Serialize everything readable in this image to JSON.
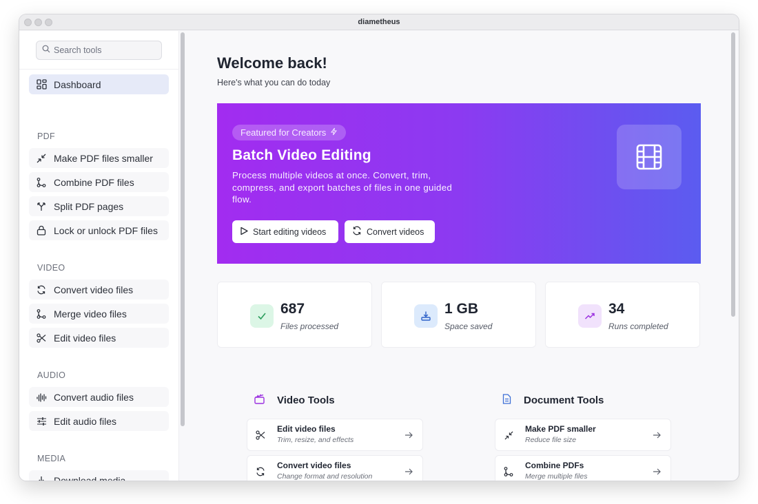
{
  "window": {
    "title": "diametheus"
  },
  "sidebar": {
    "search_placeholder": "Search tools",
    "dashboard": "Dashboard",
    "sections": [
      {
        "label": "PDF",
        "items": [
          "Make PDF files smaller",
          "Combine PDF files",
          "Split PDF pages",
          "Lock or unlock PDF files"
        ]
      },
      {
        "label": "VIDEO",
        "items": [
          "Convert video files",
          "Merge video files",
          "Edit video files"
        ]
      },
      {
        "label": "AUDIO",
        "items": [
          "Convert audio files",
          "Edit audio files"
        ]
      },
      {
        "label": "MEDIA",
        "items": [
          "Download media"
        ]
      }
    ]
  },
  "main": {
    "title": "Welcome back!",
    "subtitle": "Here's what you can do today",
    "banner": {
      "chip": "Featured for Creators",
      "title": "Batch Video Editing",
      "description": "Process multiple videos at once. Convert, trim, compress, and export batches of files in one guided flow.",
      "primary_button": "Start editing videos",
      "secondary_button": "Convert videos",
      "icon": "film-icon"
    },
    "stats": [
      {
        "value": "687",
        "label": "Files processed",
        "icon": "check-icon",
        "color": "#dcf6e6"
      },
      {
        "value": "1 GB",
        "label": "Space saved",
        "icon": "download-tray-icon",
        "color": "#dceafc"
      },
      {
        "value": "34",
        "label": "Runs completed",
        "icon": "trend-up-icon",
        "color": "#f1e2fc"
      }
    ],
    "video_tools": {
      "heading": "Video Tools",
      "items": [
        {
          "title": "Edit video files",
          "desc": "Trim, resize, and effects"
        },
        {
          "title": "Convert video files",
          "desc": "Change format and resolution"
        }
      ]
    },
    "document_tools": {
      "heading": "Document Tools",
      "items": [
        {
          "title": "Make PDF smaller",
          "desc": "Reduce file size"
        },
        {
          "title": "Combine PDFs",
          "desc": "Merge multiple files"
        }
      ]
    }
  },
  "colors": {
    "accent": "#9b30f0",
    "accent_end": "#5b5cf0",
    "active_nav": "#e6eaf8"
  }
}
